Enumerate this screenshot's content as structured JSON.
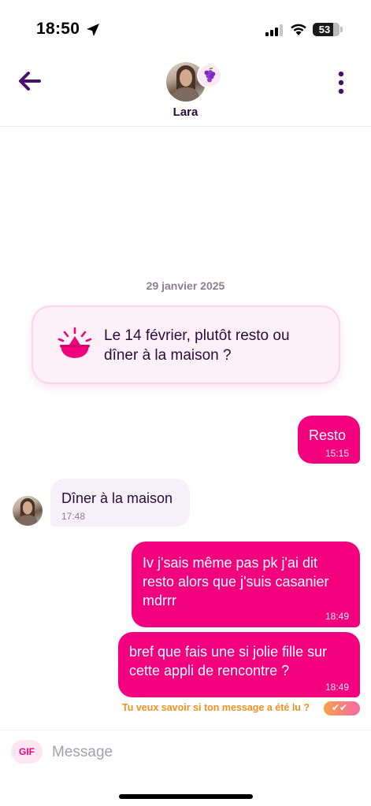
{
  "status_bar": {
    "time": "18:50",
    "battery": "53",
    "icons": [
      "location-arrow-icon",
      "cellular-signal-icon",
      "wifi-icon",
      "battery-icon"
    ]
  },
  "header": {
    "contact_name": "Lara",
    "icons": [
      "back-arrow-icon",
      "grape-icon",
      "more-vertical-icon"
    ],
    "accent": "#4a0e6b"
  },
  "chat": {
    "date": "29 janvier 2025",
    "prompt_card": {
      "icon": "lemon-juicer-icon",
      "text": "Le 14 février, plutôt resto ou dîner à la maison ?"
    },
    "messages": [
      {
        "direction": "out",
        "text": "Resto",
        "time": "15:15"
      },
      {
        "direction": "in",
        "text": "Dîner à la maison",
        "time": "17:48"
      },
      {
        "direction": "out",
        "text": "Iv j'sais même pas pk j'ai dit resto alors que j'suis casanier mdrrr",
        "time": "18:49"
      },
      {
        "direction": "out",
        "text": "bref que fais une si jolie fille sur cette appli de rencontre ?",
        "time": "18:49"
      }
    ],
    "read_receipt_prompt": "Tu veux savoir si ton message a été lu ?",
    "read_receipt_icon": "double-check-icon"
  },
  "composer": {
    "gif_label": "GIF",
    "placeholder": "Message",
    "value": ""
  },
  "colors": {
    "outgoing_bubble": "#f2007e",
    "incoming_bubble": "#f6f1f8",
    "prompt_card_bg": "#fdf0f7",
    "receipt_text": "#f0901e",
    "dark_text": "#2b0a3d"
  }
}
